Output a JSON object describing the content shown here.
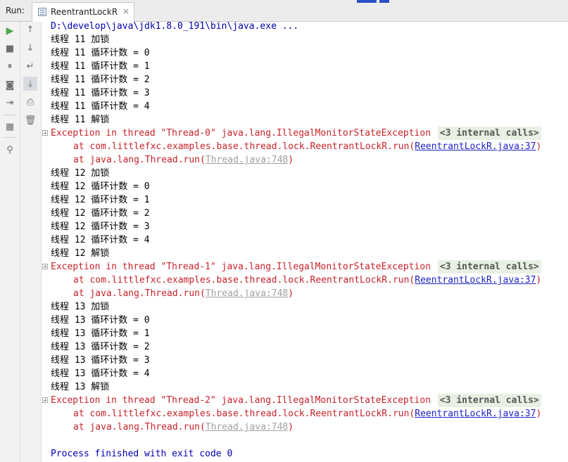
{
  "runbar": {
    "label": "Run:",
    "tab_title": "ReentrantLockR",
    "tab_close": "×"
  },
  "toolbar_left": [
    {
      "name": "run-icon",
      "glyph": "▶"
    },
    {
      "name": "stop-icon",
      "glyph": "■"
    },
    {
      "name": "pause-icon",
      "glyph": "⏸"
    },
    {
      "name": "camera-icon",
      "glyph": "◙"
    },
    {
      "name": "exit-icon",
      "glyph": "⇥"
    },
    {
      "name": "layout-icon",
      "glyph": "▦"
    },
    {
      "name": "pin-icon",
      "glyph": "⚲"
    }
  ],
  "toolbar_right": [
    {
      "name": "up-arrow-icon",
      "glyph": "↑"
    },
    {
      "name": "down-arrow-icon",
      "glyph": "↓"
    },
    {
      "name": "soft-wrap-icon",
      "glyph": "↵"
    },
    {
      "name": "scroll-to-end-icon",
      "glyph": "⤓"
    },
    {
      "name": "print-icon",
      "glyph": "⎙"
    },
    {
      "name": "trash-icon",
      "glyph": "🗑"
    }
  ],
  "console": {
    "cmd": "D:\\develop\\java\\jdk1.8.0_191\\bin\\java.exe ...",
    "blocks": [
      {
        "lines": [
          "线程 11 加锁",
          "线程 11 循环计数 = 0",
          "线程 11 循环计数 = 1",
          "线程 11 循环计数 = 2",
          "线程 11 循环计数 = 3",
          "线程 11 循环计数 = 4",
          "线程 11 解锁"
        ],
        "exception": "Exception in thread \"Thread-0\" java.lang.IllegalMonitorStateException",
        "internal": "<3 internal calls>",
        "at1_prefix": "at com.littlefxc.examples.base.thread.lock.ReentrantLockR.run(",
        "at1_link": "ReentrantLockR.java:37",
        "at1_suffix": ")",
        "at2_prefix": "at java.lang.Thread.run(",
        "at2_link": "Thread.java:748",
        "at2_suffix": ")"
      },
      {
        "lines": [
          "线程 12 加锁",
          "线程 12 循环计数 = 0",
          "线程 12 循环计数 = 1",
          "线程 12 循环计数 = 2",
          "线程 12 循环计数 = 3",
          "线程 12 循环计数 = 4",
          "线程 12 解锁"
        ],
        "exception": "Exception in thread \"Thread-1\" java.lang.IllegalMonitorStateException",
        "internal": "<3 internal calls>",
        "at1_prefix": "at com.littlefxc.examples.base.thread.lock.ReentrantLockR.run(",
        "at1_link": "ReentrantLockR.java:37",
        "at1_suffix": ")",
        "at2_prefix": "at java.lang.Thread.run(",
        "at2_link": "Thread.java:748",
        "at2_suffix": ")"
      },
      {
        "lines": [
          "线程 13 加锁",
          "线程 13 循环计数 = 0",
          "线程 13 循环计数 = 1",
          "线程 13 循环计数 = 2",
          "线程 13 循环计数 = 3",
          "线程 13 循环计数 = 4",
          "线程 13 解锁"
        ],
        "exception": "Exception in thread \"Thread-2\" java.lang.IllegalMonitorStateException",
        "internal": "<3 internal calls>",
        "at1_prefix": "at com.littlefxc.examples.base.thread.lock.ReentrantLockR.run(",
        "at1_link": "ReentrantLockR.java:37",
        "at1_suffix": ")",
        "at2_prefix": "at java.lang.Thread.run(",
        "at2_link": "Thread.java:748",
        "at2_suffix": ")"
      }
    ],
    "exit": "Process finished with exit code 0"
  },
  "colors": {
    "stdout": "#000000",
    "cmd": "#0000b0",
    "stderr": "#c7222a",
    "link": "#1c23c7",
    "link_dim": "#a0a0a0"
  }
}
